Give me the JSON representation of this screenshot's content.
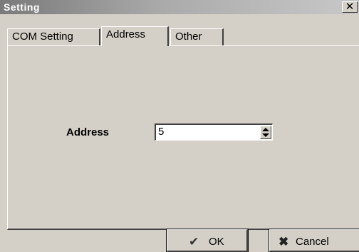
{
  "window": {
    "title": "Setting",
    "close_glyph": "✕"
  },
  "tabs": [
    {
      "label": "COM Setting",
      "selected": false
    },
    {
      "label": "Address",
      "selected": true
    },
    {
      "label": "Other",
      "selected": false
    }
  ],
  "address": {
    "label": "Address",
    "value": "5"
  },
  "buttons": {
    "ok": {
      "label": "OK",
      "icon": "checkmark-icon"
    },
    "cancel": {
      "label": "Cancel",
      "icon": "x-icon"
    }
  }
}
